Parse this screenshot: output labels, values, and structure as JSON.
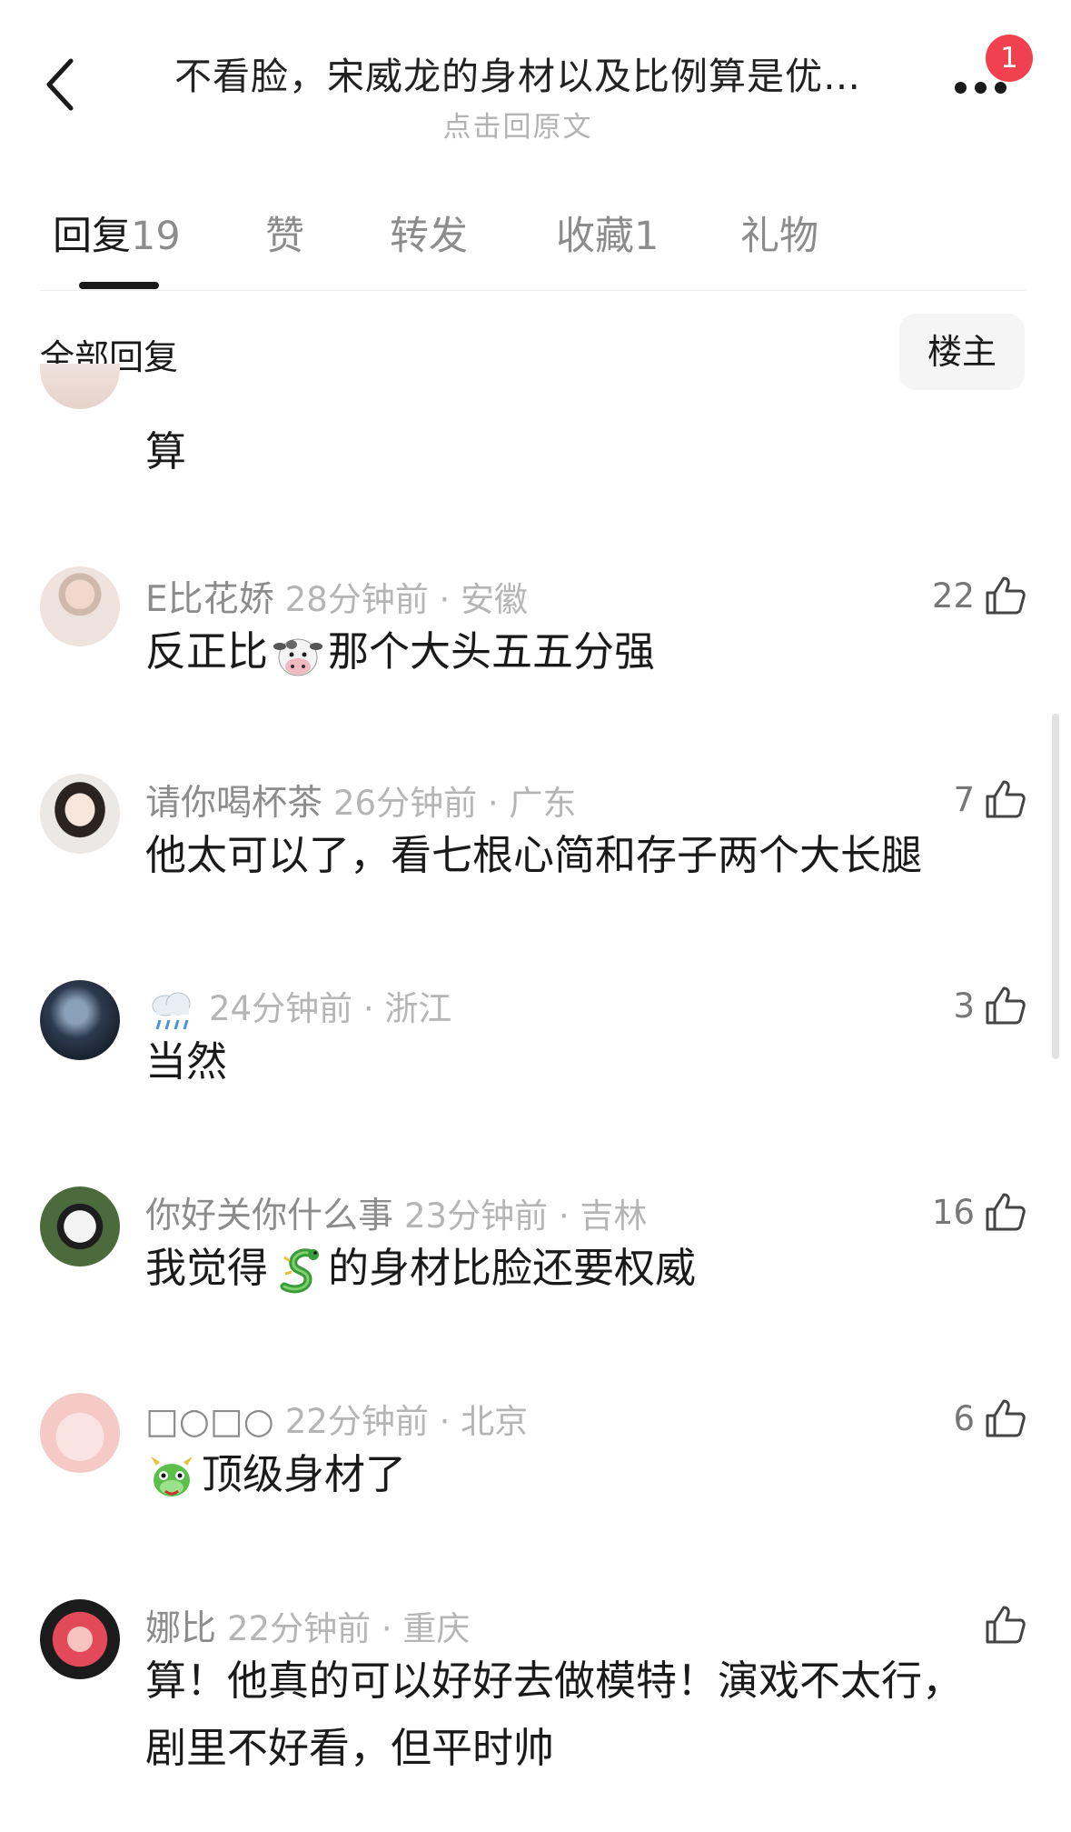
{
  "header": {
    "back_icon": "chevron-left-icon",
    "title": "不看脸，宋威龙的身材以及比例算是优…",
    "subtitle": "点击回原文",
    "more_icon": "more-dots-icon",
    "badge_count": "1"
  },
  "tabs": [
    {
      "label": "回复",
      "count": "19",
      "active": true
    },
    {
      "label": "赞",
      "count": "",
      "active": false
    },
    {
      "label": "转发",
      "count": "",
      "active": false
    },
    {
      "label": "收藏",
      "count": "1",
      "active": false
    },
    {
      "label": "礼物",
      "count": "",
      "active": false
    }
  ],
  "filter": {
    "label": "全部回复",
    "op_button": "楼主"
  },
  "comments": [
    {
      "user": "",
      "time": "",
      "text": "算",
      "likes": ""
    },
    {
      "user": "E比花娇",
      "time": "28分钟前 · 安徽",
      "text_before": "反正比",
      "emoji": "cow-face-emoji",
      "text_after": "那个大头五五分强",
      "likes": "22"
    },
    {
      "user": "请你喝杯茶",
      "time": "26分钟前 · 广东",
      "text": "他太可以了，看七根心简和存子两个大长腿",
      "likes": "7"
    },
    {
      "user_emoji": "cloud-rain-emoji",
      "time": "24分钟前 · 浙江",
      "text": "当然",
      "likes": "3"
    },
    {
      "user": "你好关你什么事",
      "time": "23分钟前 · 吉林",
      "text_before": "我觉得",
      "emoji": "dragon-emoji",
      "text_after": "的身材比脸还要权威",
      "likes": "16"
    },
    {
      "user": "□○□○",
      "time": "22分钟前 · 北京",
      "emoji": "dragon-face-emoji",
      "text_after": "顶级身材了",
      "likes": "6"
    },
    {
      "user": "娜比",
      "time": "22分钟前 · 重庆",
      "text_line1": "算！他真的可以好好去做模特！演戏不太行，",
      "text_line2": "剧里不好看，但平时帅",
      "likes": ""
    }
  ],
  "colors": {
    "badge": "#f2414e",
    "muted_text": "#8c8c8c",
    "time_text": "#b5b5b5"
  }
}
